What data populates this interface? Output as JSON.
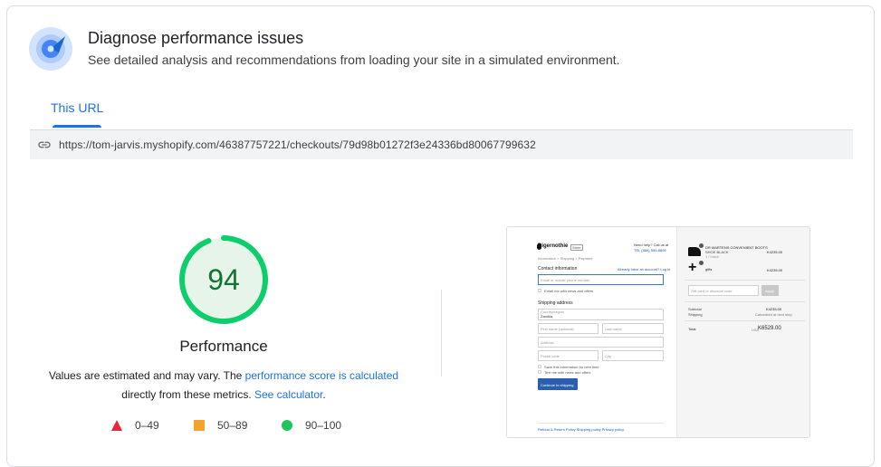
{
  "header": {
    "title": "Diagnose performance issues",
    "subtitle": "See detailed analysis and recommendations from loading your site in a simulated environment."
  },
  "tabs": [
    {
      "label": "This URL",
      "active": true
    }
  ],
  "url_bar": {
    "icon": "link-icon",
    "url": "https://tom-jarvis.myshopify.com/46387757221/checkouts/79d98b01272f3e24336bd80067799632"
  },
  "performance": {
    "score": "94",
    "score_value": 94,
    "label": "Performance",
    "description_pre": "Values are estimated and may vary. The ",
    "description_link": "performance score is calculated",
    "description_mid": "directly from these metrics. ",
    "calculator_link": "See calculator",
    "description_post": "."
  },
  "legend": [
    {
      "range": "0–49",
      "shape": "triangle",
      "color": "#e8253a"
    },
    {
      "range": "50–89",
      "shape": "square",
      "color": "#f4a229"
    },
    {
      "range": "90–100",
      "shape": "circle",
      "color": "#1ec55a"
    }
  ],
  "colors": {
    "accent": "#1a73e8",
    "good": "#0cce6b",
    "good_fill": "#e6f4ea",
    "score_text": "#137333"
  },
  "thumbnail": {
    "brand": "Digernothie",
    "brand_badge": "Store",
    "help_text": "Need help? Call us at",
    "phone": "TEL (888) 555-8899",
    "breadcrumb": "Information > Shipping > Payment",
    "contact_heading": "Contact information",
    "login_text": "Already have an account? Log in",
    "email_placeholder": "Email or mobile phone number",
    "email_offers": "Email me with news and offers",
    "shipping_heading": "Shipping address",
    "country_label": "Country/region",
    "country_value": "Zambia",
    "first_name": "First name (optional)",
    "last_name": "Last name",
    "address": "Address",
    "postal": "Postal code",
    "city": "City",
    "save_info": "Save this information for next time",
    "text_offers": "Text me with news and offers",
    "continue_button": "Continue to shipping",
    "footer_links": "Refund & Return Policy   Shipping policy   Privacy policy",
    "item1_name": "DR MARTENS CONVENIENT BOOTS",
    "item1_sub": "SHOE BLACK",
    "item1_qty": "1 / black",
    "item1_price": "K4235.00",
    "item2_name": "gifts",
    "item2_price": "K4235.00",
    "discount_placeholder": "Gift card or discount code",
    "apply_button": "Apply",
    "subtotal_label": "Subtotal",
    "subtotal_value": "K4235.00",
    "shipping_label": "Shipping",
    "shipping_value": "Calculated at next step",
    "total_label": "Total",
    "total_currency": "USD",
    "total_value": "K6529.00"
  }
}
